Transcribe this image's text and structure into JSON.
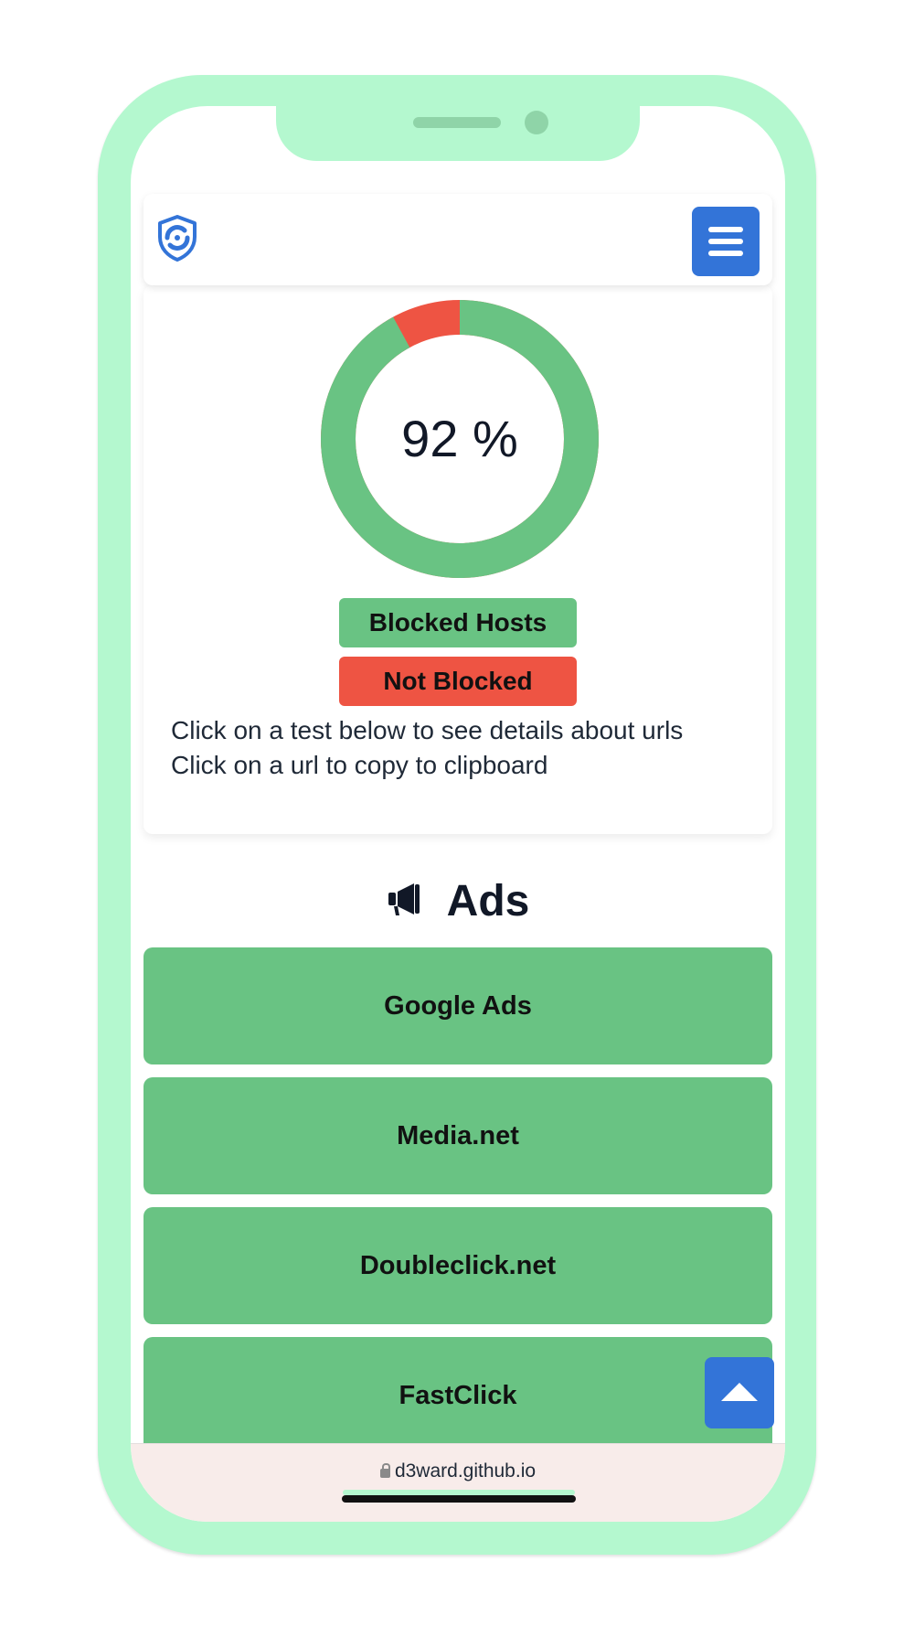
{
  "result": {
    "percent_label": "92 %",
    "blocked_fraction": 0.92,
    "legend": {
      "blocked": "Blocked Hosts",
      "not_blocked": "Not Blocked"
    },
    "instructions": [
      "Click on a test below to see details about urls",
      "Click on a url to copy to clipboard"
    ]
  },
  "section": {
    "icon": "megaphone-icon",
    "title": "Ads",
    "tests": [
      {
        "label": "Google Ads",
        "status": "blocked"
      },
      {
        "label": "Media.net",
        "status": "blocked"
      },
      {
        "label": "Doubleclick.net",
        "status": "blocked"
      },
      {
        "label": "FastClick",
        "status": "blocked"
      }
    ]
  },
  "browser": {
    "url": "d3ward.github.io"
  },
  "icons": {
    "logo": "shield-logo-icon",
    "menu": "hamburger-menu-icon",
    "scroll_top": "arrow-up-icon",
    "lock": "lock-icon"
  },
  "colors": {
    "blocked": "#69c383",
    "not_blocked": "#ee5443",
    "accent": "#3374d8",
    "phone_frame": "#b4f8cf"
  }
}
